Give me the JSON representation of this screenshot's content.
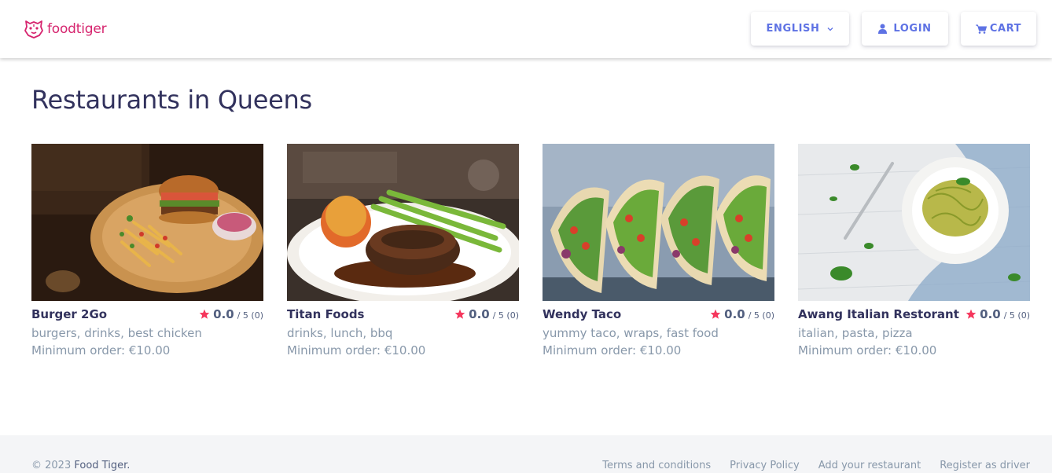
{
  "header": {
    "logo_text": "foodtiger",
    "brand_color": "#d6246e",
    "accent_color": "#5e72e4",
    "language_label": "ENGLISH",
    "login_label": "LOGIN",
    "cart_label": "CART"
  },
  "page": {
    "title": "Restaurants in Queens"
  },
  "restaurants": [
    {
      "name": "Burger 2Go",
      "rating": "0.0",
      "rating_max": "/ 5 (0)",
      "tags": "burgers, drinks, best chicken",
      "min_order": "Minimum order: €10.00",
      "image": "burger-with-fries-photo"
    },
    {
      "name": "Titan Foods",
      "rating": "0.0",
      "rating_max": "/ 5 (0)",
      "tags": "drinks, lunch, bbq",
      "min_order": "Minimum order: €10.00",
      "image": "steak-with-asparagus-photo"
    },
    {
      "name": "Wendy Taco",
      "rating": "0.0",
      "rating_max": "/ 5 (0)",
      "tags": "yummy taco, wraps, fast food",
      "min_order": "Minimum order: €10.00",
      "image": "tacos-photo"
    },
    {
      "name": "Awang Italian Restorant",
      "rating": "0.0",
      "rating_max": "/ 5 (0)",
      "tags": "italian, pasta, pizza",
      "min_order": "Minimum order: €10.00",
      "image": "pesto-pasta-photo"
    }
  ],
  "footer": {
    "copyright_prefix": "© 2023 ",
    "copyright_brand": "Food Tiger.",
    "links": [
      "Terms and conditions",
      "Privacy Policy",
      "Add your restaurant",
      "Register as driver"
    ]
  }
}
